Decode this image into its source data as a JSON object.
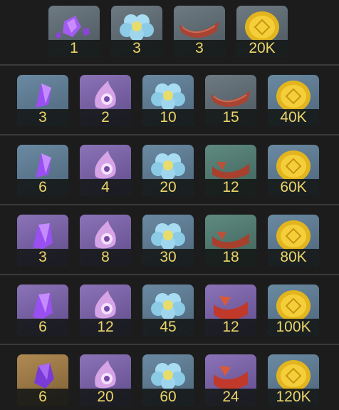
{
  "rows": [
    {
      "items": [
        {
          "icon": "purple-crystal-shards-icon",
          "qty": "1"
        },
        {
          "icon": "blue-flower-icon",
          "qty": "3"
        },
        {
          "icon": "red-scarf-icon",
          "qty": "3"
        },
        {
          "icon": "gold-coin-icon",
          "qty": "20K"
        }
      ]
    },
    {
      "items": [
        {
          "icon": "purple-crystal-icon",
          "qty": "3"
        },
        {
          "icon": "purple-flame-icon",
          "qty": "2"
        },
        {
          "icon": "blue-flower-icon",
          "qty": "10"
        },
        {
          "icon": "red-scarf-icon",
          "qty": "15"
        },
        {
          "icon": "gold-coin-icon",
          "qty": "40K"
        }
      ]
    },
    {
      "items": [
        {
          "icon": "purple-crystal-icon",
          "qty": "6"
        },
        {
          "icon": "purple-flame-icon",
          "qty": "4"
        },
        {
          "icon": "blue-flower-icon",
          "qty": "20"
        },
        {
          "icon": "red-scarf-icon",
          "qty": "12"
        },
        {
          "icon": "gold-coin-icon",
          "qty": "60K"
        }
      ]
    },
    {
      "items": [
        {
          "icon": "purple-crystal-icon",
          "qty": "3"
        },
        {
          "icon": "purple-flame-icon",
          "qty": "8"
        },
        {
          "icon": "blue-flower-icon",
          "qty": "30"
        },
        {
          "icon": "red-scarf-icon",
          "qty": "18"
        },
        {
          "icon": "gold-coin-icon",
          "qty": "80K"
        }
      ]
    },
    {
      "items": [
        {
          "icon": "purple-crystal-icon",
          "qty": "6"
        },
        {
          "icon": "purple-flame-icon",
          "qty": "12"
        },
        {
          "icon": "blue-flower-icon",
          "qty": "45"
        },
        {
          "icon": "red-scarf-icon",
          "qty": "12"
        },
        {
          "icon": "gold-coin-icon",
          "qty": "100K"
        }
      ]
    },
    {
      "items": [
        {
          "icon": "purple-gem-icon",
          "qty": "6"
        },
        {
          "icon": "purple-flame-icon",
          "qty": "20"
        },
        {
          "icon": "blue-flower-icon",
          "qty": "60"
        },
        {
          "icon": "red-scarf-icon",
          "qty": "24"
        },
        {
          "icon": "gold-coin-icon",
          "qty": "120K"
        }
      ]
    }
  ],
  "colors": {
    "qty_text": "#ecd56a",
    "divider": "#3a3a3a",
    "background": "#1c1c1c"
  }
}
